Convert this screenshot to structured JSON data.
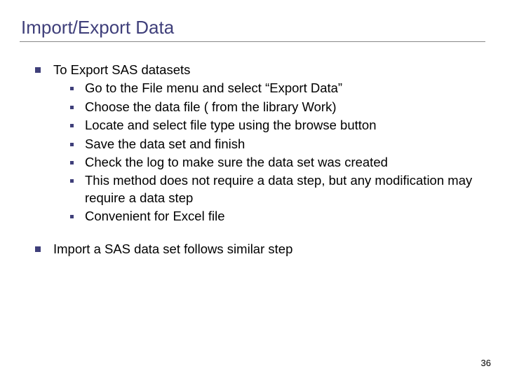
{
  "title": "Import/Export Data",
  "main": {
    "heading": "To Export SAS datasets",
    "items": [
      "Go to the File menu and select “Export Data”",
      "Choose the data file ( from the library Work)",
      "Locate and select file type using the browse button",
      "Save the data set and finish",
      "Check the log to make sure the data set was created",
      "This method does not require a data step, but any modification may require a data step",
      "Convenient for Excel file"
    ]
  },
  "second": "Import a SAS data set follows similar step",
  "page": "36"
}
